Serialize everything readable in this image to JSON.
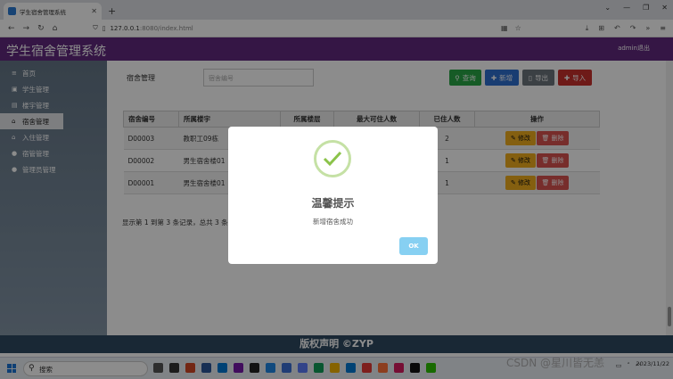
{
  "browser": {
    "tab_title": "学生宿舍管理系统",
    "url_host": "127.0.0.1",
    "url_rest": ":8080/index.html"
  },
  "header": {
    "title": "学生宿舍管理系统",
    "logout": "admin退出"
  },
  "sidebar": {
    "items": [
      {
        "label": "首页",
        "icon": "menu-icon"
      },
      {
        "label": "学生管理",
        "icon": "student-icon"
      },
      {
        "label": "楼宇管理",
        "icon": "building-icon"
      },
      {
        "label": "宿舍管理",
        "icon": "home-icon"
      },
      {
        "label": "入住管理",
        "icon": "home-icon"
      },
      {
        "label": "宿管管理",
        "icon": "user-icon"
      },
      {
        "label": "管理员管理",
        "icon": "user-icon"
      }
    ],
    "active_index": 3
  },
  "search": {
    "label": "宿舍管理",
    "placeholder": "宿舍编号",
    "query_btn": "查询",
    "add_btn": "新增",
    "export_btn": "导出",
    "import_btn": "导入"
  },
  "table": {
    "headers": [
      "宿舍编号",
      "所属楼宇",
      "所属楼层",
      "最大可住人数",
      "已住人数",
      "操作"
    ],
    "rows": [
      {
        "id": "D00003",
        "building": "教职工09栋",
        "floor": "",
        "max": "",
        "current": "2"
      },
      {
        "id": "D00002",
        "building": "男生宿舍楼01",
        "floor": "",
        "max": "",
        "current": "1"
      },
      {
        "id": "D00001",
        "building": "男生宿舍楼01",
        "floor": "",
        "max": "",
        "current": "1"
      }
    ],
    "edit_label": "修改",
    "delete_label": "删除"
  },
  "pagination": {
    "text": "显示第 1 到第 3 条记录，总共 3 条"
  },
  "footer": {
    "text": "版权声明 ©ZYP"
  },
  "dialog": {
    "title": "温馨提示",
    "message": "新增宿舍成功",
    "ok": "OK"
  },
  "taskbar": {
    "search": "搜索",
    "clock_time": "",
    "clock_date": "2023/11/22"
  },
  "watermark": "CSDN @星川皆无恙",
  "colors": {
    "header": "#61297f",
    "query": "#28a745",
    "add": "#2f6fcf",
    "export": "#6c757d",
    "import": "#c9302c",
    "footer": "#2f4a62"
  }
}
